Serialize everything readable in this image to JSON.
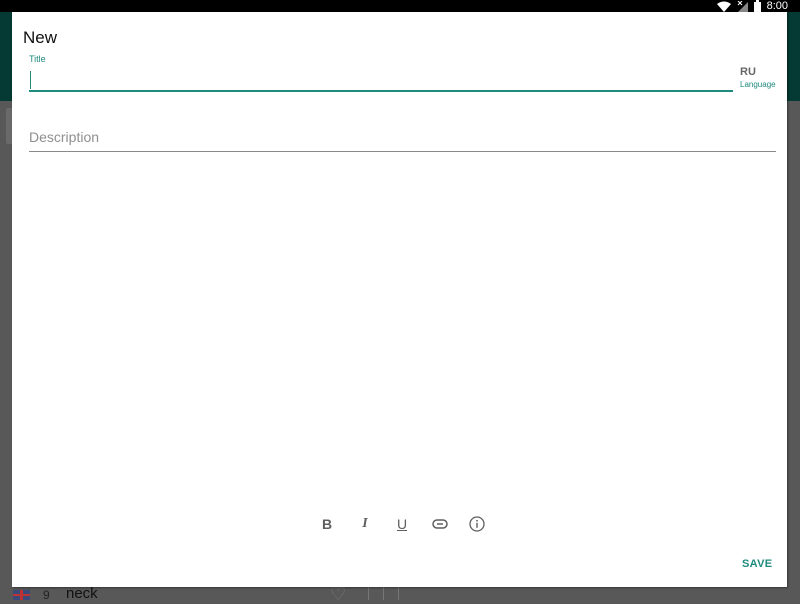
{
  "status_bar": {
    "time": "8:00",
    "icons": [
      "wifi-icon",
      "no-signal-icon",
      "battery-icon"
    ]
  },
  "background": {
    "list_row": {
      "index": "9",
      "word": "neck",
      "flag": "uk-flag-icon"
    }
  },
  "dialog": {
    "title": "New",
    "title_field": {
      "label": "Title",
      "value": "",
      "placeholder": ""
    },
    "language": {
      "code": "RU",
      "label": "Language"
    },
    "description_field": {
      "value": "",
      "placeholder": "Description"
    },
    "toolbar": {
      "bold": "B",
      "italic": "I",
      "underline": "U",
      "link_icon": "link-icon",
      "info_icon": "info-icon"
    },
    "save_label": "SAVE"
  },
  "colors": {
    "accent": "#1f8a7e",
    "app_bar": "#043a33",
    "scrim": "#585858"
  }
}
